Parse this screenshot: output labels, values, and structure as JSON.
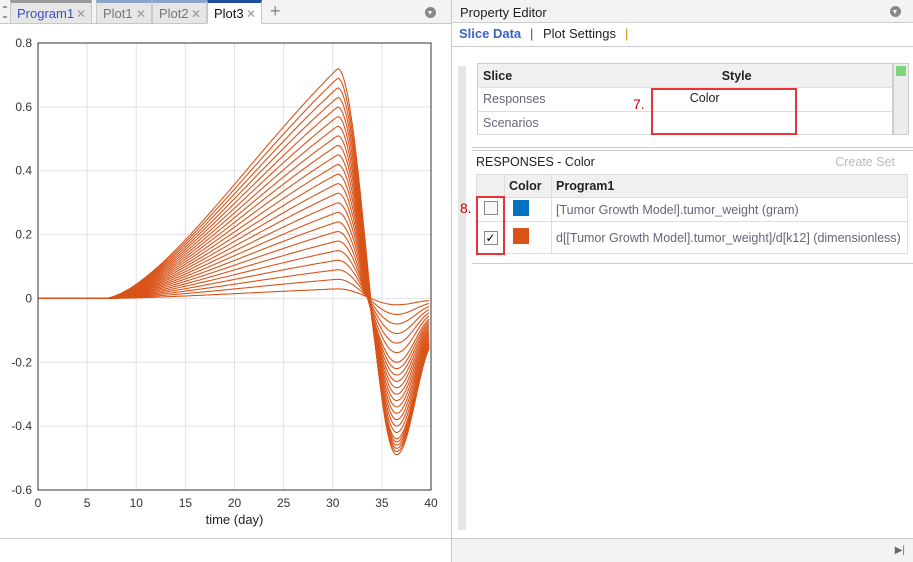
{
  "tabs": [
    {
      "label": "Program1"
    },
    {
      "label": "Plot1"
    },
    {
      "label": "Plot2"
    },
    {
      "label": "Plot3"
    }
  ],
  "add_tab": "+",
  "property_editor": {
    "title": "Property Editor",
    "subtabs": [
      "Slice Data",
      "Plot Settings"
    ],
    "slice_table": {
      "headers": [
        "Slice",
        "Style"
      ],
      "rows": [
        {
          "slice": "Responses",
          "style": "Color"
        },
        {
          "slice": "Scenarios",
          "style": ""
        }
      ]
    },
    "annotation_7": "7.",
    "annotation_8": "8.",
    "responses_title": "RESPONSES - Color",
    "create_set": "Create Set",
    "responses_table": {
      "headers": [
        "",
        "Color",
        "Program1"
      ],
      "rows": [
        {
          "checked": false,
          "check_mark": "",
          "color": "#0072bd",
          "label": "[Tumor Growth Model].tumor_weight (gram)"
        },
        {
          "checked": true,
          "check_mark": "✓",
          "color": "#d95319",
          "label": "d[[Tumor Growth Model].tumor_weight]/d[k12] (dimensionless)"
        }
      ]
    }
  },
  "chart_data": {
    "type": "line",
    "xlabel": "time (day)",
    "ylabel": "",
    "xlim": [
      0,
      40
    ],
    "ylim": [
      -0.6,
      0.8
    ],
    "xticks": [
      0,
      5,
      10,
      15,
      20,
      25,
      30,
      35,
      40
    ],
    "yticks": [
      -0.6,
      -0.4,
      -0.2,
      0,
      0.2,
      0.4,
      0.6,
      0.8
    ],
    "grid": true,
    "color": "#d95319",
    "series_description": "sensitivity curves family: zero until ~7 day, peak near day 30.5, trough near day 36.5",
    "peaks": [
      0.72,
      0.69,
      0.66,
      0.63,
      0.6,
      0.57,
      0.54,
      0.51,
      0.48,
      0.45,
      0.42,
      0.39,
      0.36,
      0.33,
      0.3,
      0.27,
      0.24,
      0.21,
      0.18,
      0.15,
      0.12,
      0.09,
      0.06,
      0.03
    ],
    "troughs": [
      -0.49,
      -0.48,
      -0.47,
      -0.46,
      -0.45,
      -0.44,
      -0.42,
      -0.4,
      -0.38,
      -0.36,
      -0.34,
      -0.32,
      -0.3,
      -0.28,
      -0.26,
      -0.24,
      -0.22,
      -0.2,
      -0.17,
      -0.14,
      -0.11,
      -0.08,
      -0.05,
      -0.02
    ]
  }
}
